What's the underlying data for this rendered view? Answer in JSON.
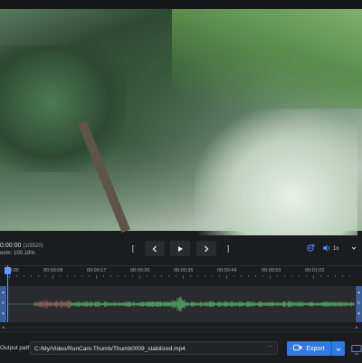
{
  "player": {
    "time": "0:00:00",
    "frames": "(1/3520)",
    "zoom": "oom: 100.18%",
    "controls": {
      "mark_in": "[",
      "mark_out": "]",
      "prev_icon": "chevron-left-icon",
      "play_icon": "play-icon",
      "next_icon": "chevron-right-icon"
    },
    "speed": "1x",
    "progress_fraction": 0.0
  },
  "timeline": {
    "ticks": [
      "0:00",
      "00:00:08",
      "00:00:17",
      "00:00:26",
      "00:00:35",
      "00:00:44",
      "00:00:53",
      "00:01:02"
    ]
  },
  "output": {
    "label": "Output path:",
    "path": "C:/My/Video/RunCam-Thumb/Thumb0009_stabilized.mp4",
    "browse": "...",
    "export_label": "Export"
  },
  "colors": {
    "accent": "#2f7be5",
    "waveform": "#4f9a63",
    "playhead": "#5d9bff"
  }
}
